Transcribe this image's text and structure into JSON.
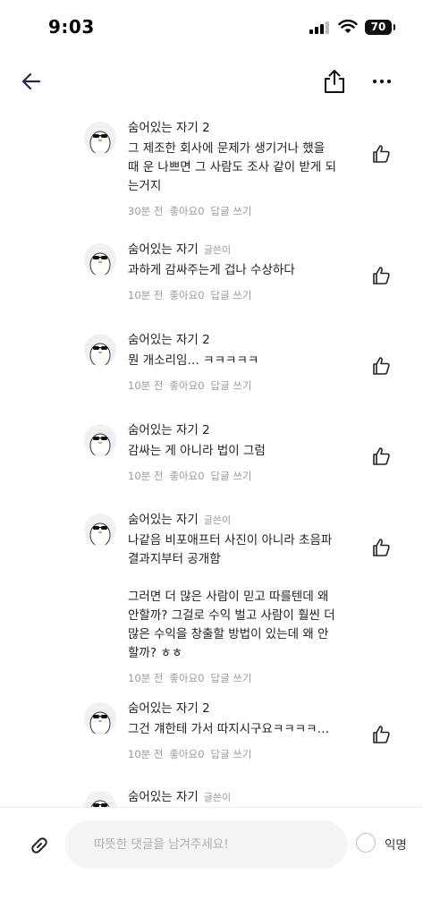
{
  "status_bar": {
    "time": "9:03",
    "battery": "70"
  },
  "comments": [
    {
      "author": "숨어있는 자기 2",
      "badge": "",
      "text": "그 제조한 회사에 문제가 생기거나 했을\n때 운 나쁘면 그 사람도 조사 같이 받게 되\n는거지",
      "time": "30분 전",
      "likes": "좋아요0",
      "reply": "답글 쓰기"
    },
    {
      "author": "숨어있는 자기",
      "badge": "글쓴이",
      "text": "과하게 감싸주는게 겁나 수상하다",
      "time": "10분 전",
      "likes": "좋아요0",
      "reply": "답글 쓰기"
    },
    {
      "author": "숨어있는 자기 2",
      "badge": "",
      "text": "뭔 개소리임… ㅋㅋㅋㅋㅋ",
      "time": "10분 전",
      "likes": "좋아요0",
      "reply": "답글 쓰기"
    },
    {
      "author": "숨어있는 자기 2",
      "badge": "",
      "text": "감싸는 게 아니라 법이 그럼",
      "time": "10분 전",
      "likes": "좋아요0",
      "reply": "답글 쓰기"
    },
    {
      "author": "숨어있는 자기",
      "badge": "글쓴이",
      "text": "나같음 비포애프터 사진이 아니라 초음파\n결과지부터 공개함\n\n그러면 더 많은 사람이 믿고 따를텐데 왜\n안할까? 그걸로 수익 벌고 사람이 훨씬 더\n많은 수익을 창출할 방법이 있는데 왜 안\n할까? ㅎㅎ",
      "time": "10분 전",
      "likes": "좋아요0",
      "reply": "답글 쓰기"
    },
    {
      "author": "숨어있는 자기 2",
      "badge": "",
      "text": "그건 걔한테 가서 따지시구요ㅋㅋㅋㅋ…",
      "time": "10분 전",
      "likes": "좋아요0",
      "reply": "답글 쓰기"
    },
    {
      "author": "숨어있는 자기",
      "badge": "글쓴이",
      "text": "",
      "time": "",
      "likes": "",
      "reply": ""
    }
  ],
  "composer": {
    "placeholder": "따뜻한 댓글을 남겨주세요!",
    "anon_label": "익명"
  },
  "colors": {
    "text": "#222222",
    "meta": "#9a9a9a",
    "input_bg": "#f4f4f4"
  },
  "icons": [
    "back-arrow-icon",
    "share-icon",
    "more-icon",
    "avatar-penguin",
    "thumbs-up-icon",
    "paperclip-icon"
  ]
}
